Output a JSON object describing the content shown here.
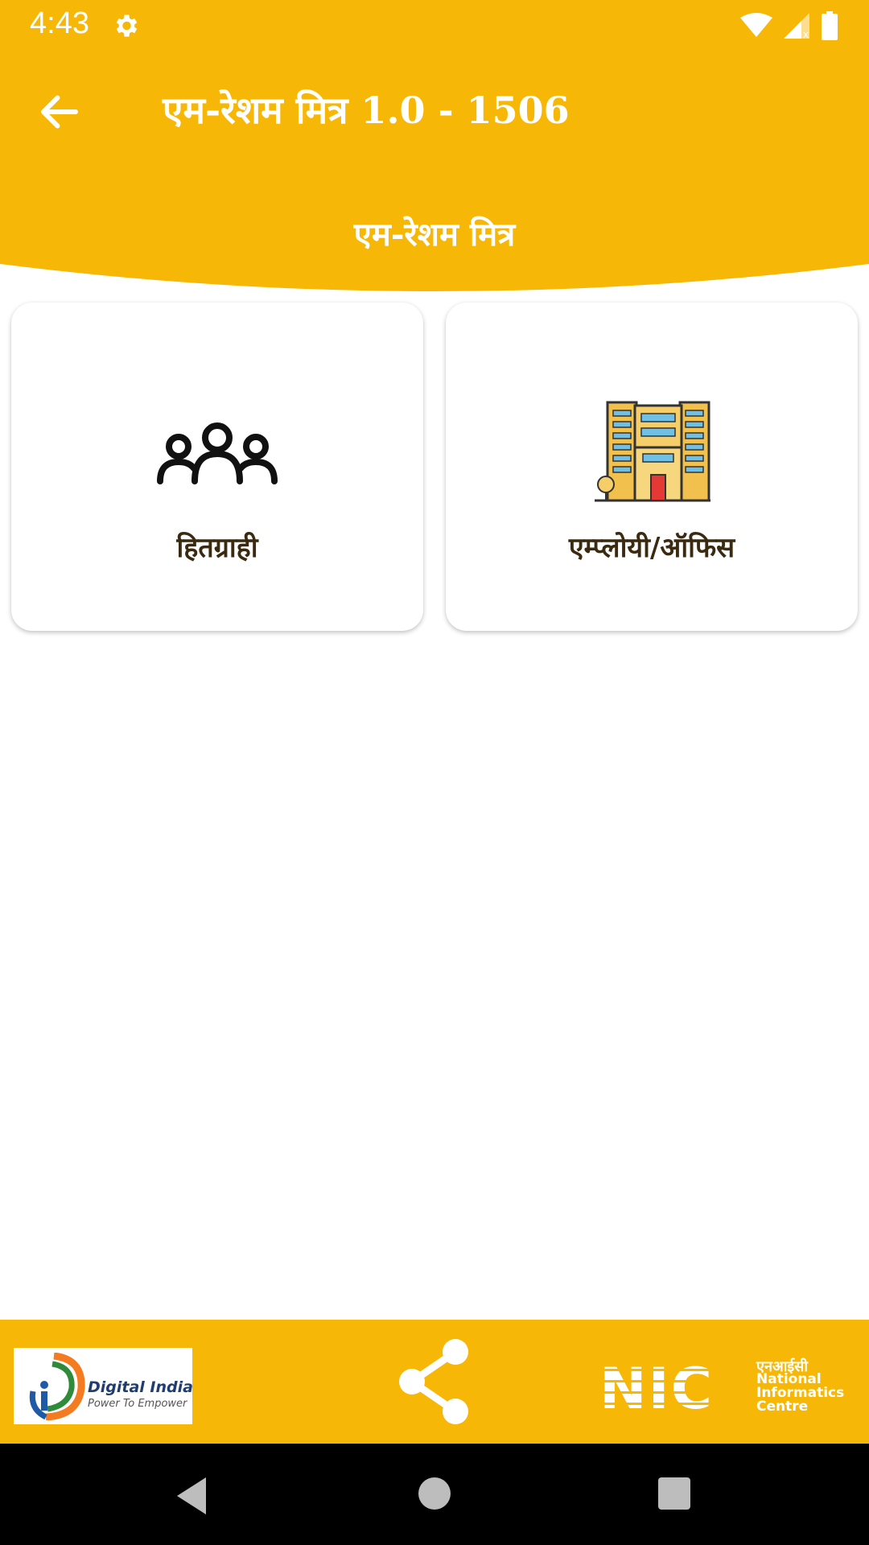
{
  "status_bar": {
    "time": "4:43",
    "icons": [
      "gear-icon",
      "wifi-icon",
      "signal-icon",
      "battery-icon"
    ]
  },
  "app_bar": {
    "title": "एम-रेशम मित्र 1.0 - 1506",
    "back_icon": "arrow-left-icon"
  },
  "subheader": {
    "title": "एम-रेशम मित्र"
  },
  "cards": [
    {
      "label": "हितग्राही",
      "icon": "people-group-icon"
    },
    {
      "label": "एम्प्लोयी/ऑफिस",
      "icon": "office-building-icon"
    }
  ],
  "footer": {
    "digital_india": {
      "title": "Digital India",
      "tagline": "Power To Empower"
    },
    "share_icon": "share-icon",
    "nic": {
      "letters": "NIC",
      "hindi": "एनआईसी",
      "line1": "National",
      "line2": "Informatics",
      "line3": "Centre"
    }
  },
  "colors": {
    "primary": "#F7B707",
    "label_text": "#3a2a10"
  }
}
